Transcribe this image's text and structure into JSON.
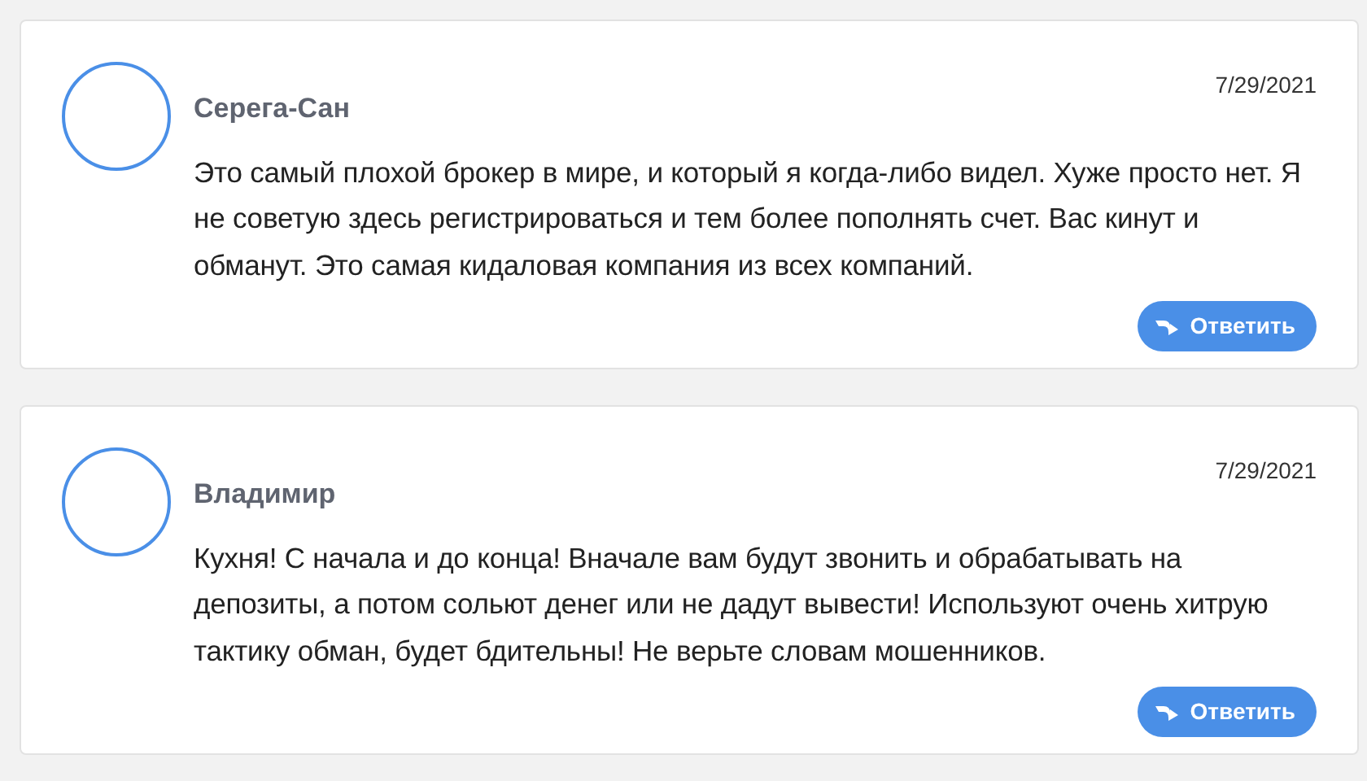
{
  "comments": [
    {
      "author": "Серега-Сан",
      "date": "7/29/2021",
      "text": "Это самый плохой брокер в мире, и который я когда-либо видел. Хуже просто нет. Я не советую здесь регистрироваться и тем более пополнять счет. Вас кинут и обманут. Это самая кидаловая компания из всех компаний.",
      "reply_label": "Ответить"
    },
    {
      "author": "Владимир",
      "date": "7/29/2021",
      "text": "Кухня! С начала и до конца! Вначале вам будут звонить и обрабатывать на депозиты, а потом сольют денег или не дадут вывести! Используют очень хитрую тактику обман, будет бдительны! Не верьте словам мошенников.",
      "reply_label": "Ответить"
    }
  ]
}
